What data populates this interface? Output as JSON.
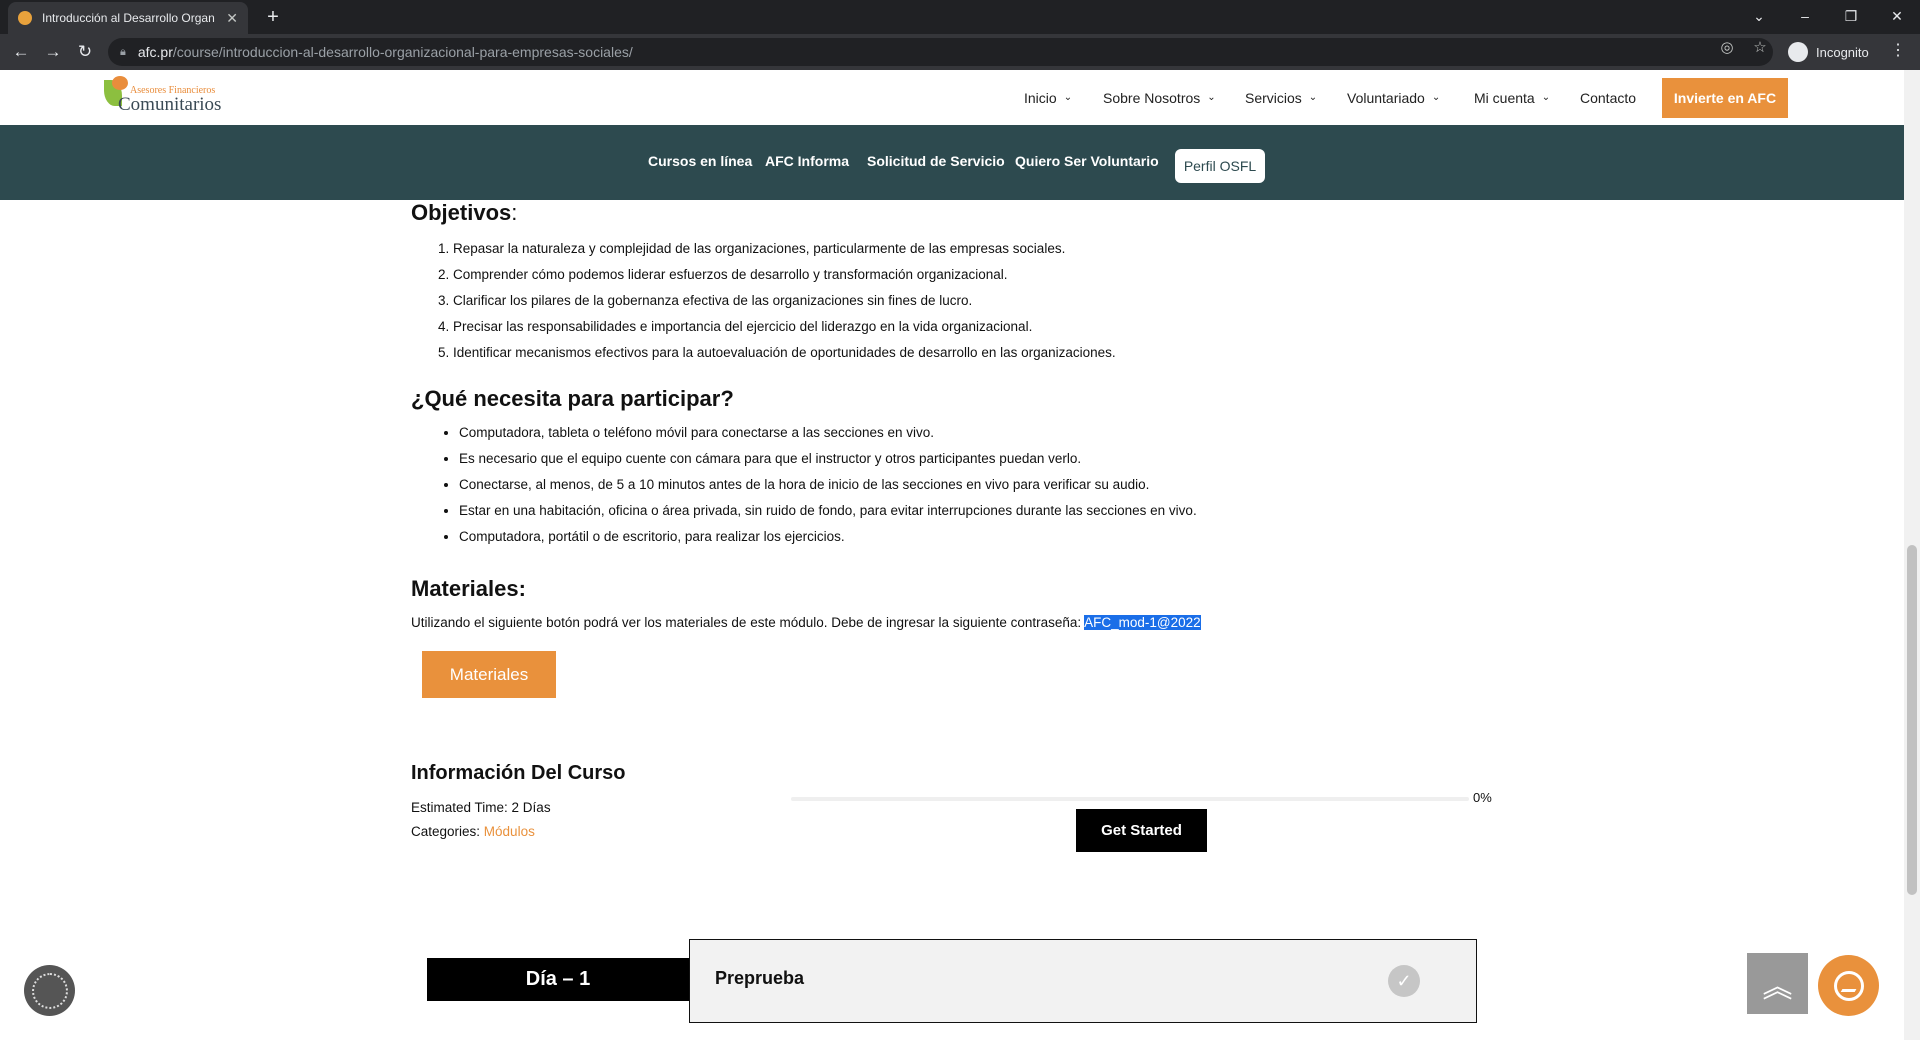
{
  "browser": {
    "tab_title": "Introducción al Desarrollo Organ",
    "new_tab": "+",
    "url_host": "afc.pr",
    "url_path": "/course/introduccion-al-desarrollo-organizacional-para-empresas-sociales/",
    "incognito_label": "Incognito"
  },
  "header": {
    "logo_small": "Asesores Financieros",
    "logo_big": "Comunitarios",
    "nav": [
      {
        "label": "Inicio"
      },
      {
        "label": "Sobre Nosotros"
      },
      {
        "label": "Servicios"
      },
      {
        "label": "Voluntariado"
      },
      {
        "label": "Mi cuenta"
      },
      {
        "label": "Contacto"
      }
    ],
    "cta": "Invierte en AFC"
  },
  "subnav": {
    "items": [
      "Cursos en línea",
      "AFC Informa",
      "Solicitud de Servicio",
      "Quiero Ser Voluntario"
    ],
    "pill": "Perfil OSFL"
  },
  "content": {
    "objetivos_title": "Objetivos",
    "objetivos_colon": ":",
    "objetivos": [
      "Repasar la naturaleza y complejidad de las organizaciones, particularmente de las empresas sociales.",
      "Comprender cómo podemos liderar esfuerzos de desarrollo y transformación organizacional.",
      "Clarificar los pilares de la gobernanza efectiva de las organizaciones sin fines de lucro.",
      "Precisar las responsabilidades e importancia del ejercicio del liderazgo en la vida organizacional.",
      "Identificar mecanismos efectivos para la autoevaluación de oportunidades de desarrollo en las organizaciones."
    ],
    "requisitos_title": "¿Qué necesita para participar?",
    "requisitos": [
      "Computadora, tableta o teléfono móvil para conectarse a las secciones en vivo.",
      "Es necesario que el equipo cuente con cámara para que el instructor y otros participantes puedan verlo.",
      "Conectarse, al menos, de 5 a 10 minutos antes de la hora de inicio de las secciones en vivo para verificar su audio.",
      "Estar en una habitación, oficina o área privada, sin ruido de fondo, para evitar interrupciones durante las secciones en vivo.",
      "Computadora, portátil o de escritorio, para realizar los ejercicios."
    ],
    "materiales_title": "Materiales:",
    "materiales_text": "Utilizando el siguiente botón podrá ver los materiales de este módulo. Debe de ingresar la siguiente contraseña: ",
    "password": "AFC_mod-1@2022",
    "materiales_button": "Materiales"
  },
  "course_info": {
    "title": "Información Del Curso",
    "estimated_label": "Estimated Time: ",
    "estimated_value": "2 Días",
    "categories_label": "Categories: ",
    "categories_value": "Módulos",
    "progress_text": "0%",
    "progress_value": 0,
    "start_button": "Get Started"
  },
  "lessons": {
    "day_label": "Día – 1",
    "lesson_title": "Preprueba"
  },
  "colors": {
    "accent": "#e9913c",
    "subnav_bg": "#2d4a4f",
    "selection": "#1a6ee8"
  }
}
